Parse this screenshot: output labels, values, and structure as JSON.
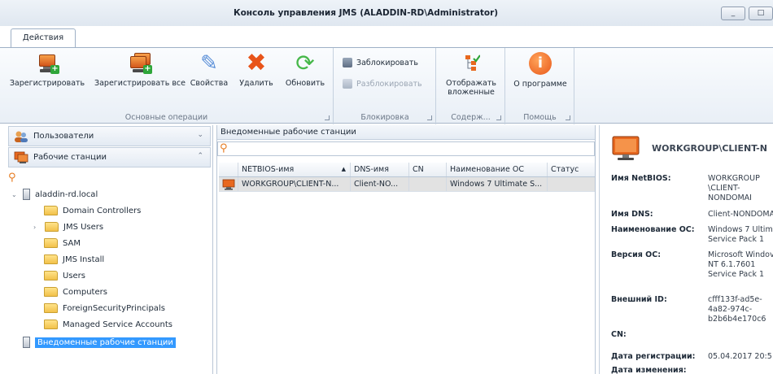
{
  "window": {
    "title": "Консоль управления JMS (ALADDIN-RD\\Administrator)",
    "minimize": "_",
    "maximize": "□"
  },
  "ribbon": {
    "tab": "Действия",
    "groups": {
      "basic": {
        "label": "Основные операции",
        "register": "Зарегистрировать",
        "register_all": "Зарегистрировать все",
        "properties": "Свойства",
        "delete": "Удалить",
        "refresh": "Обновить"
      },
      "lock": {
        "label": "Блокировка",
        "lock": "Заблокировать",
        "unlock": "Разблокировать"
      },
      "content": {
        "label": "Содерж...",
        "show_nested": "Отображать вложенные"
      },
      "help": {
        "label": "Помощь",
        "about": "О программе"
      }
    }
  },
  "navigation": {
    "users": "Пользователи",
    "workstations": "Рабочие станции"
  },
  "tree": {
    "root": "aladdin-rd.local",
    "items": [
      "Domain Controllers",
      "JMS Users",
      "SAM",
      "JMS Install",
      "Users",
      "Computers",
      "ForeignSecurityPrincipals",
      "Managed Service Accounts"
    ],
    "selected": "Внедоменные рабочие станции"
  },
  "list": {
    "title": "Внедоменные рабочие станции",
    "columns": [
      "NETBIOS-имя",
      "DNS-имя",
      "CN",
      "Наименование ОС",
      "Статус"
    ],
    "rows": [
      [
        "WORKGROUP\\CLIENT-N...",
        "Client-NO...",
        "",
        "Windows 7 Ultimate S...",
        ""
      ]
    ]
  },
  "details": {
    "title": "WORKGROUP\\CLIENT-N",
    "props": [
      {
        "k": "Имя NetBIOS:",
        "v": "WORKGROUP\n\\CLIENT-\nNONDOMAI"
      },
      {
        "k": "Имя DNS:",
        "v": "Client-NONDOMA"
      },
      {
        "k": "Наименование ОС:",
        "v": "Windows 7 Ultim\nService Pack 1"
      },
      {
        "k": "Версия ОС:",
        "v": "Microsoft Windov\nNT 6.1.7601\nService Pack 1"
      },
      {
        "k": "Внешний ID:",
        "v": "cfff133f-ad5e-\n4a82-974c-\nb2b6b4e170c6"
      },
      {
        "k": "CN:",
        "v": ""
      },
      {
        "k": "Дата регистрации:",
        "v": "05.04.2017 20:5"
      },
      {
        "k": "Дата изменения:",
        "v": ""
      }
    ]
  },
  "icons": {
    "monitor": "monitor-icon",
    "search": "search-icon",
    "folder": "folder-icon",
    "server": "server-icon"
  },
  "colors": {
    "accent": "#3399ff",
    "monitor_orange": "#e8681f",
    "delete_red": "#e8541a",
    "refresh_green": "#47b84a"
  }
}
